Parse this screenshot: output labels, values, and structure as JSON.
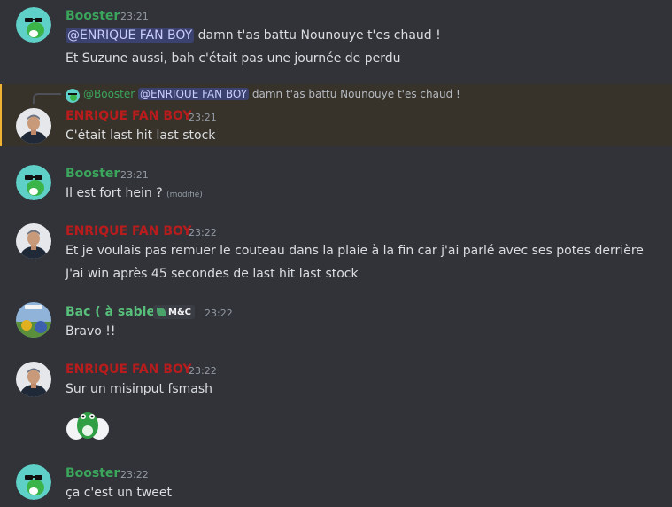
{
  "colors": {
    "booster": "#3ba55c",
    "enrique": "#b91c1c",
    "bac": "#57c07a",
    "reply_highlight": "#f0b232",
    "mention_bg": "#3c4270"
  },
  "messages": [
    {
      "author": "Booster",
      "time": "23:21",
      "mention": "@ENRIQUE FAN BOY",
      "text1": "damn t'as battu Nounouye t'es chaud !",
      "text2": "Et Suzune aussi, bah c'était pas une journée de perdu"
    },
    {
      "reply": {
        "author": "@Booster",
        "mention": "@ENRIQUE FAN BOY",
        "text": "damn t'as battu Nounouye t'es chaud !"
      },
      "author": "ENRIQUE FAN BOY",
      "time": "23:21",
      "text": "C'était last hit last stock"
    },
    {
      "author": "Booster",
      "time": "23:21",
      "text": "Il est fort hein ?",
      "edited": "(modifié)"
    },
    {
      "author": "ENRIQUE FAN BOY",
      "time": "23:22",
      "text1": "Et je voulais pas remuer le couteau dans la plaie à la fin car j'ai parlé avec ses potes derrière",
      "text2": "J'ai win après 45 secondes de last hit last stock"
    },
    {
      "author": "Bac ( à sable )",
      "tag": "M&C",
      "time": "23:22",
      "text": "Bravo !!"
    },
    {
      "author": "ENRIQUE FAN BOY",
      "time": "23:22",
      "text": "Sur un misinput fsmash",
      "emoji": "yoshi-egg-emoji"
    },
    {
      "author": "Booster",
      "time": "23:22",
      "text": "ça c'est un tweet"
    }
  ]
}
